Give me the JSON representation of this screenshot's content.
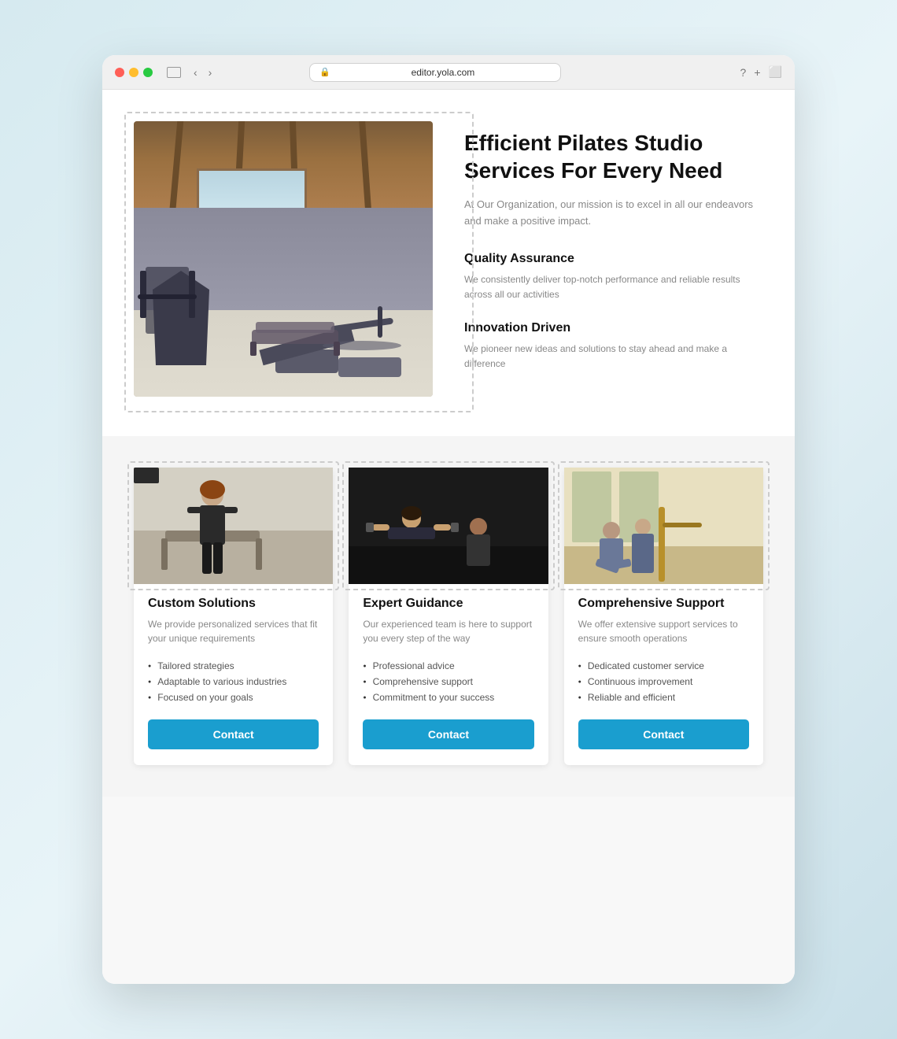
{
  "browser": {
    "url": "editor.yola.com",
    "traffic_lights": [
      "red",
      "yellow",
      "green"
    ]
  },
  "hero": {
    "title": "Efficient Pilates Studio Services For Every Need",
    "subtitle": "At Our Organization, our mission is to excel in all our endeavors and make a positive impact.",
    "features": [
      {
        "title": "Quality Assurance",
        "description": "We consistently deliver top-notch performance and reliable results across all our activities"
      },
      {
        "title": "Innovation Driven",
        "description": "We pioneer new ideas and solutions to stay ahead and make a difference"
      }
    ]
  },
  "cards": [
    {
      "title": "Custom Solutions",
      "description": "We provide personalized services that fit your unique requirements",
      "list": [
        "Tailored strategies",
        "Adaptable to various industries",
        "Focused on your goals"
      ],
      "button": "Contact"
    },
    {
      "title": "Expert Guidance",
      "description": "Our experienced team is here to support you every step of the way",
      "list": [
        "Professional advice",
        "Comprehensive support",
        "Commitment to your success"
      ],
      "button": "Contact"
    },
    {
      "title": "Comprehensive Support",
      "description": "We offer extensive support services to ensure smooth operations",
      "list": [
        "Dedicated customer service",
        "Continuous improvement",
        "Reliable and efficient"
      ],
      "button": "Contact"
    }
  ],
  "colors": {
    "accent": "#1a9ecf",
    "text_dark": "#111111",
    "text_muted": "#888888"
  }
}
